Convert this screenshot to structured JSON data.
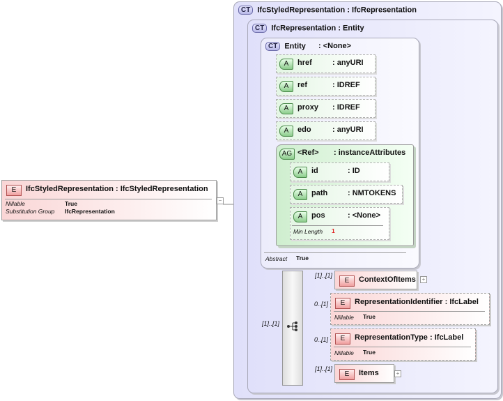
{
  "root": {
    "badge": "E",
    "name": "IfcStyledRepresentation",
    "type": ": IfcStyledRepresentation",
    "props": [
      {
        "k": "Nillable",
        "v": "True"
      },
      {
        "k": "Substitution Group",
        "v": "IfcRepresentation"
      }
    ],
    "toggle": "−"
  },
  "ct_outer": {
    "badge": "CT",
    "name": "IfcStyledRepresentation",
    "type": ": IfcRepresentation"
  },
  "ct_inner": {
    "badge": "CT",
    "name": "IfcRepresentation",
    "type": ": Entity"
  },
  "ct_entity": {
    "badge": "CT",
    "name": "Entity",
    "type": ": <None>",
    "abstract_label": "Abstract",
    "abstract_value": "True"
  },
  "attrs": [
    {
      "badge": "A",
      "name": "href",
      "type": ": anyURI"
    },
    {
      "badge": "A",
      "name": "ref",
      "type": ": IDREF"
    },
    {
      "badge": "A",
      "name": "proxy",
      "type": ": IDREF"
    },
    {
      "badge": "A",
      "name": "edo",
      "type": ": anyURI"
    }
  ],
  "group": {
    "badge": "AG",
    "name": "<Ref>",
    "type": ": instanceAttributes",
    "attrs": [
      {
        "badge": "A",
        "name": "id",
        "type": ": ID"
      },
      {
        "badge": "A",
        "name": "path",
        "type": ": NMTOKENS"
      },
      {
        "badge": "A",
        "name": "pos",
        "type": ": <None>",
        "prop_k": "Min Length",
        "prop_v": "1"
      }
    ]
  },
  "sequence": {
    "mult": "[1]..[1]"
  },
  "elements": [
    {
      "badge": "E",
      "name": "ContextOfItems",
      "mult": "[1]..[1]",
      "plus": "+"
    },
    {
      "badge": "E",
      "name": "RepresentationIdentifier",
      "type": ": IfcLabel",
      "mult": "0..[1]",
      "prop_k": "Nillable",
      "prop_v": "True"
    },
    {
      "badge": "E",
      "name": "RepresentationType",
      "type": ": IfcLabel",
      "mult": "0..[1]",
      "prop_k": "Nillable",
      "prop_v": "True"
    },
    {
      "badge": "E",
      "name": "Items",
      "mult": "[1]..[1]",
      "plus": "+"
    }
  ]
}
